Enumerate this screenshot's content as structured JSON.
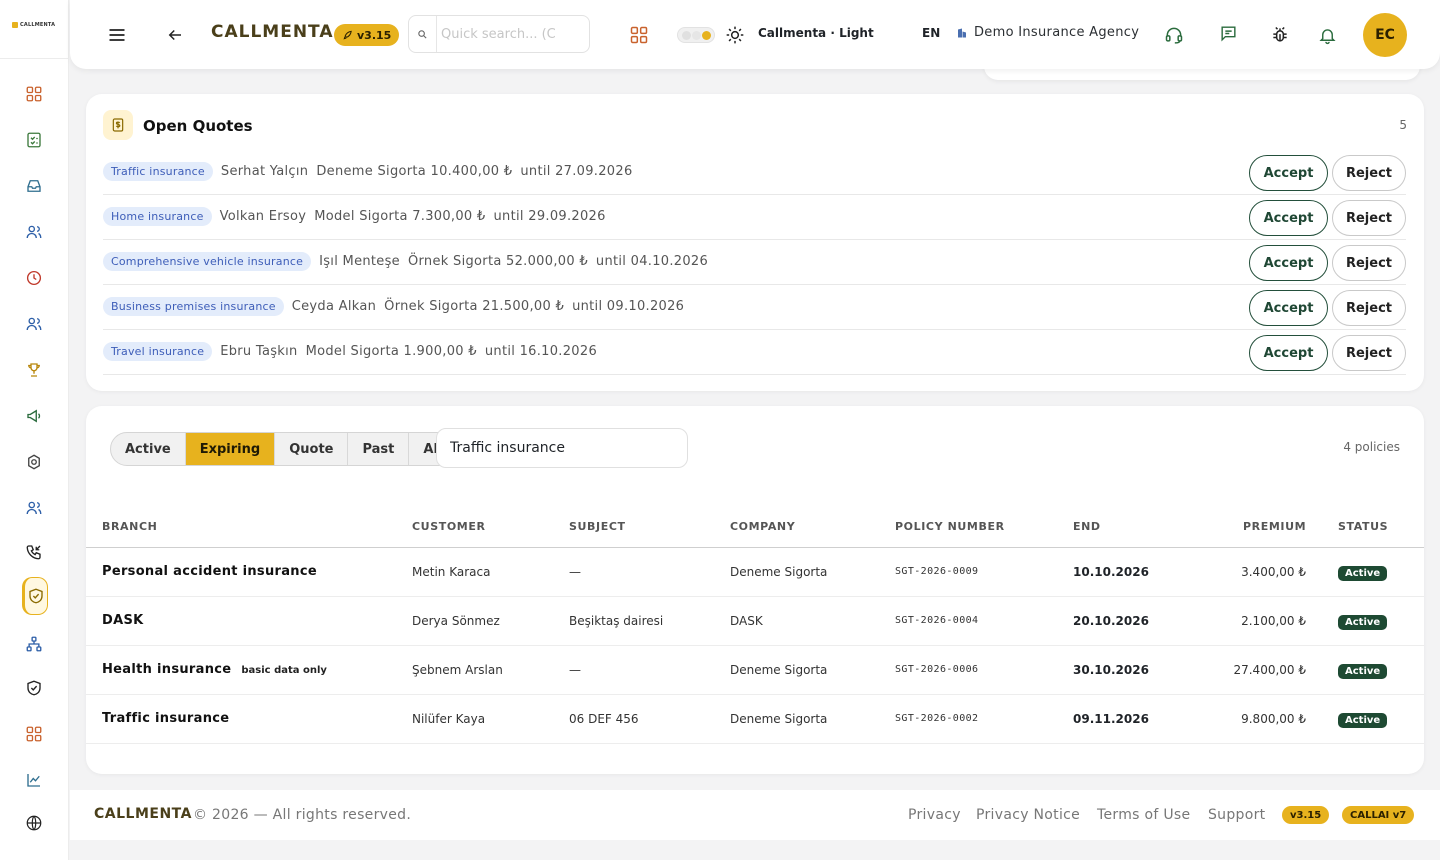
{
  "app": {
    "logo_text": "CALLMENTA",
    "brand": "CALLMENTA",
    "version": "v3.15"
  },
  "colors": {
    "accent": "#e7b21e",
    "accept_border": "#234f3b",
    "status_active": "#1e4a33",
    "chip_bg": "#e3ecfb",
    "chip_text": "#3d5db8"
  },
  "sidebar": {
    "items": [
      {
        "icon": "dashboard-grid-icon"
      },
      {
        "icon": "checklist-icon"
      },
      {
        "icon": "inbox-icon"
      },
      {
        "icon": "users-icon"
      },
      {
        "icon": "clock-icon"
      },
      {
        "icon": "team-icon"
      },
      {
        "icon": "trophy-icon"
      },
      {
        "icon": "megaphone-icon"
      },
      {
        "icon": "puzzle-icon"
      },
      {
        "icon": "contacts-icon"
      },
      {
        "icon": "phone-incoming-icon"
      },
      {
        "icon": "shield-check-icon",
        "active": true
      },
      {
        "icon": "org-chart-icon"
      },
      {
        "icon": "shield-icon"
      },
      {
        "icon": "apps-grid-icon"
      },
      {
        "icon": "chart-line-icon"
      },
      {
        "icon": "globe-icon"
      }
    ]
  },
  "header": {
    "search_placeholder": "Quick search... (C",
    "theme_label": "Callmenta · Light",
    "language": "EN",
    "agency": "Demo Insurance Agency",
    "avatar_initials": "EC"
  },
  "quotes": {
    "title": "Open Quotes",
    "count": "5",
    "accept_label": "Accept",
    "reject_label": "Reject",
    "rows": [
      {
        "branch": "Traffic insurance",
        "customer": "Serhat Yalçın",
        "company_amount": "Deneme Sigorta 10.400,00 ₺",
        "until": "until 27.09.2026"
      },
      {
        "branch": "Home insurance",
        "customer": "Volkan Ersoy",
        "company_amount": "Model Sigorta 7.300,00 ₺",
        "until": "until 29.09.2026"
      },
      {
        "branch": "Comprehensive vehicle insurance",
        "customer": "Işıl Menteşe",
        "company_amount": "Örnek Sigorta 52.000,00 ₺",
        "until": "until 04.10.2026"
      },
      {
        "branch": "Business premises insurance",
        "customer": "Ceyda Alkan",
        "company_amount": "Örnek Sigorta 21.500,00 ₺",
        "until": "until 09.10.2026"
      },
      {
        "branch": "Travel insurance",
        "customer": "Ebru Taşkın",
        "company_amount": "Model Sigorta 1.900,00 ₺",
        "until": "until 16.10.2026"
      }
    ]
  },
  "policies": {
    "tabs": [
      "Active",
      "Expiring",
      "Quote",
      "Past",
      "All"
    ],
    "selected_tab": "Expiring",
    "filter_value": "Traffic insurance",
    "count": "4 policies",
    "columns": [
      "BRANCH",
      "CUSTOMER",
      "SUBJECT",
      "COMPANY",
      "POLICY NUMBER",
      "END",
      "PREMIUM",
      "STATUS"
    ],
    "rows": [
      {
        "branch": "Personal accident insurance",
        "note": "",
        "customer": "Metin Karaca",
        "subject": "—",
        "company": "Deneme Sigorta",
        "policy_number": "SGT-2026-0009",
        "end": "10.10.2026",
        "premium": "3.400,00 ₺",
        "status": "Active"
      },
      {
        "branch": "DASK",
        "note": "",
        "customer": "Derya Sönmez",
        "subject": "Beşiktaş dairesi",
        "company": "DASK",
        "policy_number": "SGT-2026-0004",
        "end": "20.10.2026",
        "premium": "2.100,00 ₺",
        "status": "Active"
      },
      {
        "branch": "Health insurance",
        "note": "basic data only",
        "customer": "Şebnem Arslan",
        "subject": "—",
        "company": "Deneme Sigorta",
        "policy_number": "SGT-2026-0006",
        "end": "30.10.2026",
        "premium": "27.400,00 ₺",
        "status": "Active"
      },
      {
        "branch": "Traffic insurance",
        "note": "",
        "customer": "Nilüfer Kaya",
        "subject": "06 DEF 456",
        "company": "Deneme Sigorta",
        "policy_number": "SGT-2026-0002",
        "end": "09.11.2026",
        "premium": "9.800,00 ₺",
        "status": "Active"
      }
    ]
  },
  "footer": {
    "brand": "CALLMENTA",
    "copyright": "© 2026 — All rights reserved.",
    "links": [
      "Privacy",
      "Privacy Notice",
      "Terms of Use",
      "Support"
    ],
    "version_badge": "v3.15",
    "ai_badge": "CALLAI v7"
  }
}
